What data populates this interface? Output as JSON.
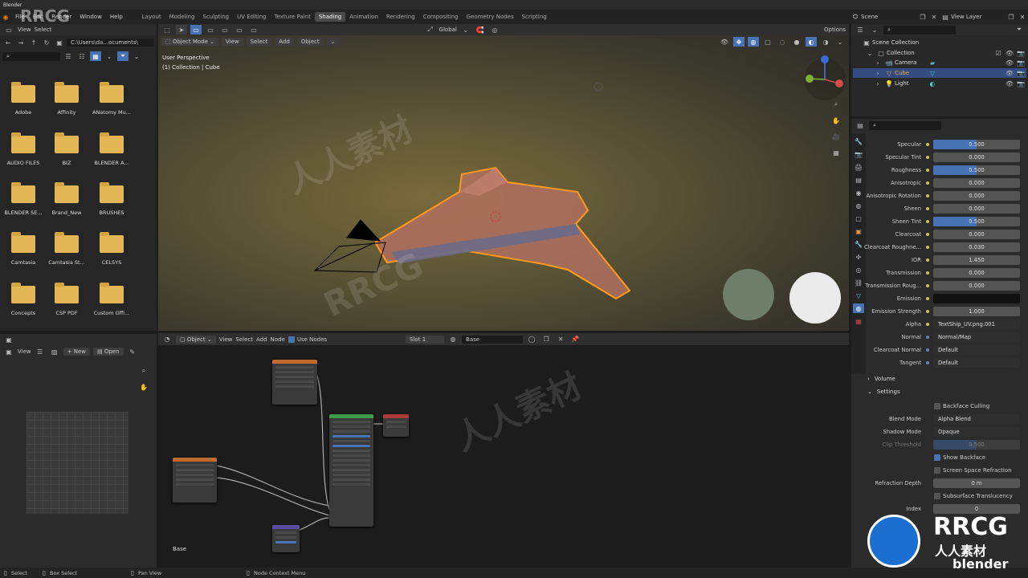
{
  "window_title": "Blender",
  "menu": [
    "File",
    "Edit",
    "Render",
    "Window",
    "Help"
  ],
  "workspaces": [
    "Layout",
    "Modeling",
    "Sculpting",
    "UV Editing",
    "Texture Paint",
    "Shading",
    "Animation",
    "Rendering",
    "Compositing",
    "Geometry Nodes",
    "Scripting"
  ],
  "active_workspace": "Shading",
  "scene": "Scene",
  "view_layer": "View Layer",
  "file_browser": {
    "menus": [
      "View",
      "Select"
    ],
    "path": "C:\\Users\\da...ocuments\\",
    "folders": [
      "Adobe",
      "Affinity",
      "ANatomy Mu...",
      "AUDIO FILES",
      "BIZ",
      "BLENDER A...",
      "BLENDER SE...",
      "Brand_New",
      "BRUSHES",
      "Camtasia",
      "Camtasia St...",
      "CELSYS",
      "Concepts",
      "CSP PDF",
      "Custom Offi..."
    ]
  },
  "image_editor": {
    "view": "View",
    "new": "New",
    "open": "Open"
  },
  "viewport": {
    "mode": "Object Mode",
    "menus": [
      "View",
      "Select",
      "Add",
      "Object"
    ],
    "orientation": "Global",
    "options": "Options",
    "perspective": "User Perspective",
    "collection_label": "(1) Collection | Cube"
  },
  "node_editor": {
    "type": "Object",
    "menus": [
      "View",
      "Select",
      "Add",
      "Node"
    ],
    "use_nodes": "Use Nodes",
    "slot": "Slot 1",
    "material": "Base",
    "frame_label": "Base"
  },
  "outliner": {
    "root": "Scene Collection",
    "collection": "Collection",
    "items": [
      "Camera",
      "Cube",
      "Light"
    ]
  },
  "properties": {
    "rows": [
      {
        "label": "Specular",
        "value": "0.500",
        "fill": 0.5
      },
      {
        "label": "Specular Tint",
        "value": "0.000"
      },
      {
        "label": "Roughness",
        "value": "0.500",
        "fill": 0.5
      },
      {
        "label": "Anisotropic",
        "value": "0.000"
      },
      {
        "label": "Anisotropic Rotation",
        "value": "0.000"
      },
      {
        "label": "Sheen",
        "value": "0.000"
      },
      {
        "label": "Sheen Tint",
        "value": "0.500",
        "fill": 0.5
      },
      {
        "label": "Clearcoat",
        "value": "0.000"
      },
      {
        "label": "Clearcoat Roughne...",
        "value": "0.030"
      },
      {
        "label": "IOR",
        "value": "1.450"
      },
      {
        "label": "Transmission",
        "value": "0.000"
      },
      {
        "label": "Transmission Roug...",
        "value": "0.000"
      },
      {
        "label": "Emission",
        "value": ""
      },
      {
        "label": "Emission Strength",
        "value": "1.000"
      },
      {
        "label": "Alpha",
        "value": "TextShip_UV.png.001"
      },
      {
        "label": "Normal",
        "value": "Normal/Map"
      },
      {
        "label": "Clearcoat Normal",
        "value": "Default"
      },
      {
        "label": "Tangent",
        "value": "Default"
      }
    ],
    "volume": "Volume",
    "settings": "Settings",
    "backface_culling": "Backface Culling",
    "blend_mode_label": "Blend Mode",
    "blend_mode": "Alpha Blend",
    "shadow_mode_label": "Shadow Mode",
    "shadow_mode": "Opaque",
    "clip_threshold_label": "Clip Threshold",
    "clip_threshold": "0.500",
    "show_backface": "Show Backface",
    "screen_space_refraction": "Screen Space Refraction",
    "refraction_depth_label": "Refraction Depth",
    "refraction_depth": "0 m",
    "subsurface_translucency": "Subsurface Translucency",
    "pass_index_label": "Index",
    "pass_index": "0"
  },
  "statusbar": {
    "select": "Select",
    "box_select": "Box Select",
    "pan_view": "Pan View",
    "node_context": "Node Context Menu"
  },
  "watermarks": [
    "RRCG",
    "人人素材",
    "RRCG",
    "人人素材"
  ],
  "logo": {
    "rrcg": "RRCG",
    "cn": "人人素材",
    "blender": "blender"
  }
}
